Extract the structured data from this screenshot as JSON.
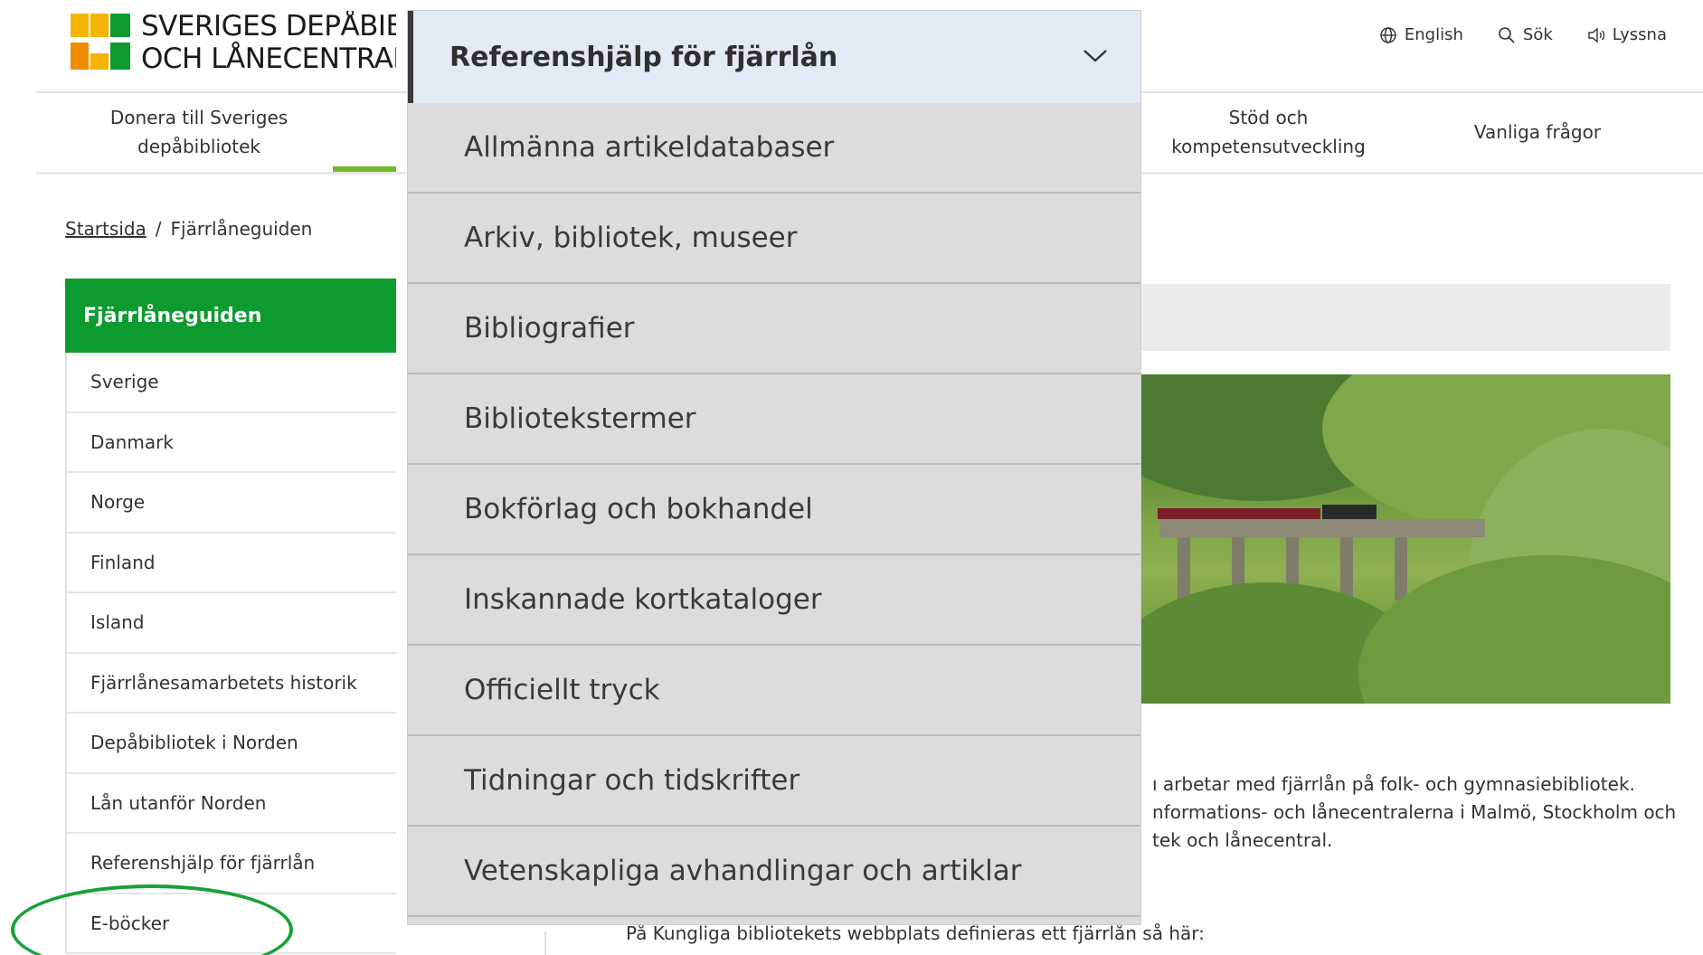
{
  "header": {
    "logo_lines": [
      "SVERIGES DEPÅBIBLIOTEK",
      "OCH LÅNECENTRAL"
    ],
    "utility_links": [
      {
        "label": "English",
        "icon": "globe-icon"
      },
      {
        "label": "Sök",
        "icon": "search-icon"
      },
      {
        "label": "Lyssna",
        "icon": "speaker-icon"
      }
    ]
  },
  "nav": {
    "donate_line1": "Donera till Sveriges",
    "donate_line2": "depåbibliotek",
    "stod_line1": "Stöd och",
    "stod_line2": "kompetensutveckling",
    "faq": "Vanliga frågor"
  },
  "breadcrumb": {
    "home": "Startsida",
    "separator": "/",
    "current": "Fjärrlåneguiden"
  },
  "sidenav": {
    "title": "Fjärrlåneguiden",
    "items": [
      "Sverige",
      "Danmark",
      "Norge",
      "Finland",
      "Island",
      "Fjärrlånesamarbetets historik",
      "Depåbibliotek i Norden",
      "Lån utanför Norden",
      "Referenshjälp för fjärrlån",
      "E-böcker"
    ]
  },
  "dropdown": {
    "title": "Referenshjälp för fjärrlån",
    "items": [
      "Allmänna artikeldatabaser",
      "Arkiv, bibliotek, museer",
      "Bibliografier",
      "Bibliotekstermer",
      "Bokförlag och bokhandel",
      "Inskannade kortkataloger",
      "Officiellt tryck",
      "Tidningar och tidskrifter",
      "Vetenskapliga avhandlingar och artiklar"
    ]
  },
  "content": {
    "para_lines": [
      "ı arbetar med fjärrlån på folk- och gymnasiebibliotek.",
      "nformations- och lånecentralerna i Malmö, Stockholm och",
      "tek och lånecentral."
    ],
    "bottom_line": "På Kungliga bibliotekets webbplats definieras ett fjärrlån så här:"
  },
  "colors": {
    "green_primary": "#0d9b2f",
    "nav_active": "#73b72b",
    "dropdown_bg": "#dcdcdc",
    "dropdown_header_bg": "#e2ebf5",
    "ellipse": "#18a138"
  }
}
